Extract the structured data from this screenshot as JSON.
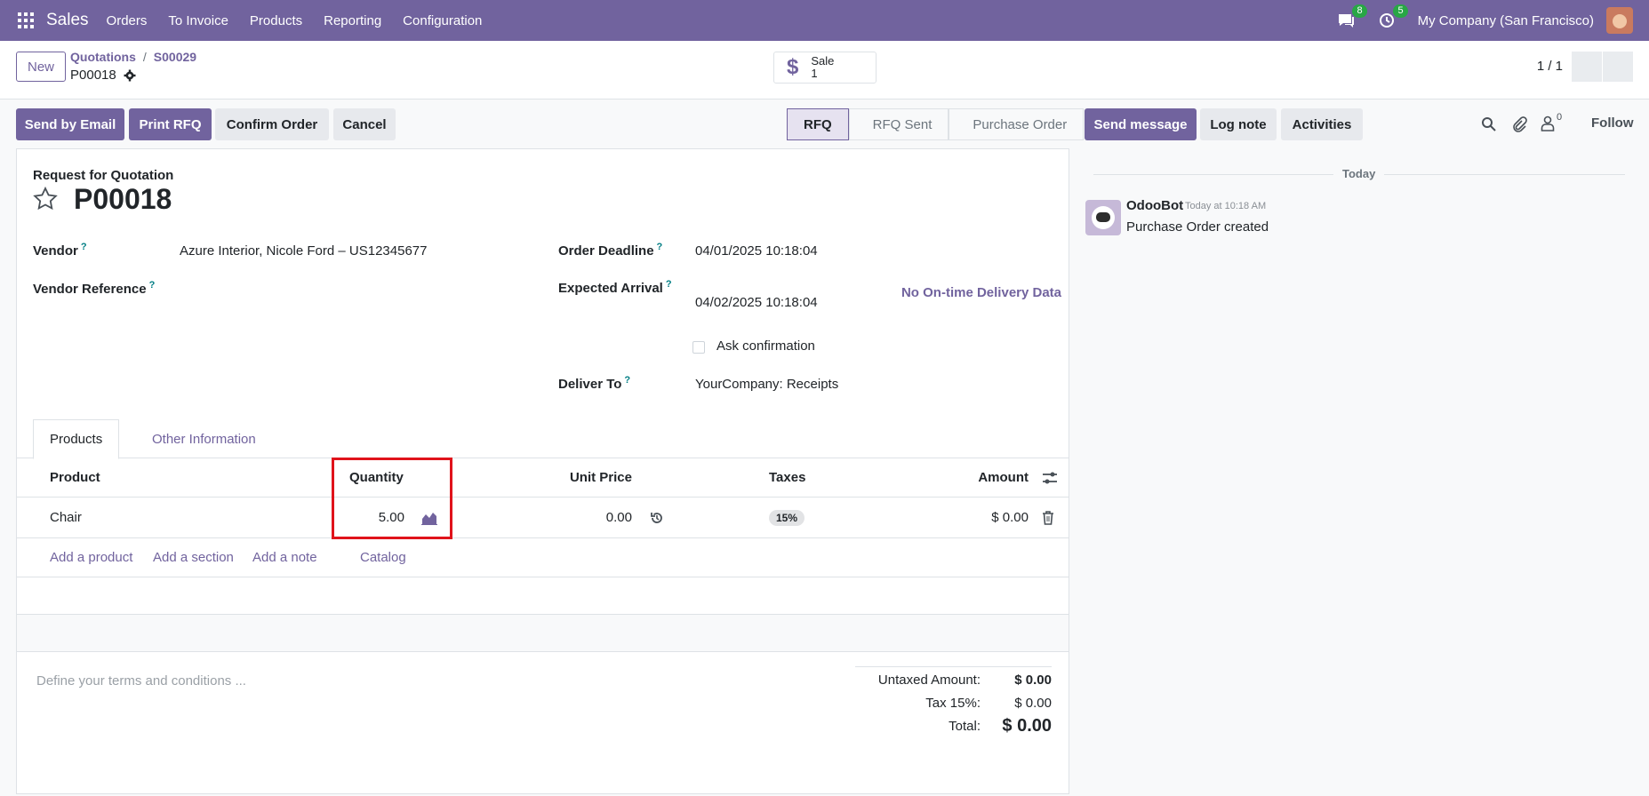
{
  "navbar": {
    "app_name": "Sales",
    "menu": [
      "Orders",
      "To Invoice",
      "Products",
      "Reporting",
      "Configuration"
    ],
    "messages_badge": "8",
    "activities_badge": "5",
    "company": "My Company (San Francisco)"
  },
  "control": {
    "new_label": "New",
    "breadcrumb": [
      "Quotations",
      "S00029"
    ],
    "record_name": "P00018",
    "smart_button": {
      "title": "Sale",
      "count": "1"
    },
    "pager": "1 / 1"
  },
  "actions": {
    "send_email": "Send by Email",
    "print_rfq": "Print RFQ",
    "confirm_order": "Confirm Order",
    "cancel": "Cancel"
  },
  "status": [
    "RFQ",
    "RFQ Sent",
    "Purchase Order"
  ],
  "chatter": {
    "send_message": "Send message",
    "log_note": "Log note",
    "activities": "Activities",
    "followers_count": "0",
    "follow": "Follow",
    "date_separator": "Today",
    "message": {
      "author": "OdooBot",
      "time": "Today at 10:18 AM",
      "body": "Purchase Order created"
    }
  },
  "form": {
    "subtitle": "Request for Quotation",
    "title": "P00018",
    "fields": {
      "vendor_label": "Vendor",
      "vendor_value": "Azure Interior, Nicole Ford – US12345677",
      "vendor_ref_label": "Vendor Reference",
      "order_deadline_label": "Order Deadline",
      "order_deadline_value": "04/01/2025 10:18:04",
      "expected_arrival_label": "Expected Arrival",
      "expected_arrival_value": "04/02/2025 10:18:04",
      "ask_confirmation": "Ask confirmation",
      "deliver_to_label": "Deliver To",
      "deliver_to_value": "YourCompany: Receipts",
      "help_mark": "?"
    },
    "delivery_data": "No On-time Delivery Data",
    "tabs": [
      "Products",
      "Other Information"
    ],
    "table": {
      "headers": [
        "Product",
        "Quantity",
        "Unit Price",
        "Taxes",
        "Amount"
      ],
      "rows": [
        {
          "product": "Chair",
          "quantity": "5.00",
          "unit_price": "0.00",
          "taxes": "15%",
          "amount": "$ 0.00"
        }
      ],
      "add_links": [
        "Add a product",
        "Add a section",
        "Add a note",
        "Catalog"
      ]
    },
    "terms_placeholder": "Define your terms and conditions ...",
    "totals": {
      "untaxed_label": "Untaxed Amount:",
      "untaxed_value": "$ 0.00",
      "tax_label": "Tax 15%:",
      "tax_value": "$ 0.00",
      "total_label": "Total:",
      "total_value": "$ 0.00"
    }
  },
  "colors": {
    "brand": "#71639e",
    "highlight": "#e0131b",
    "badge": "#28a745"
  }
}
